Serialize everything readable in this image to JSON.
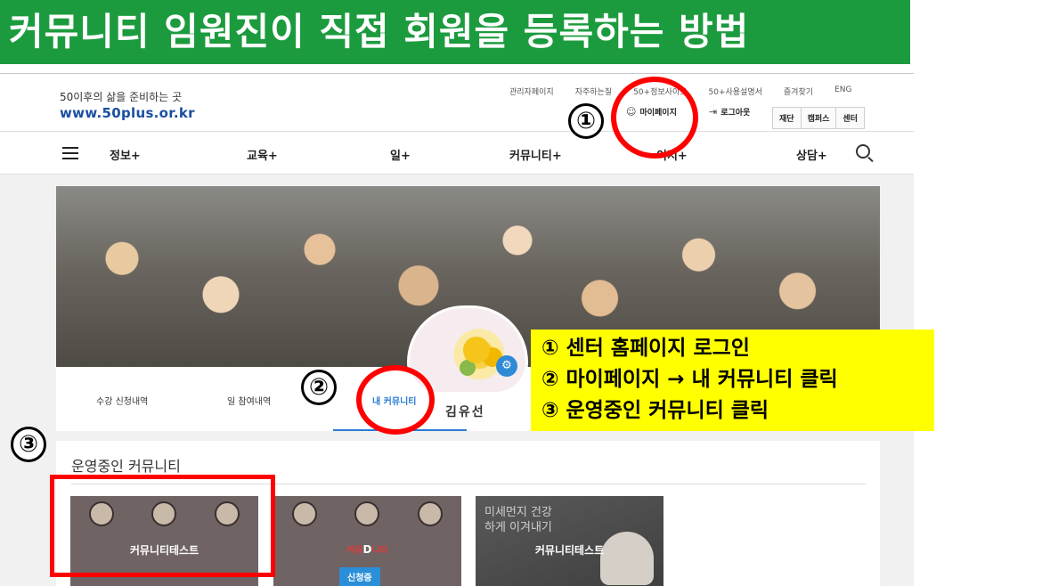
{
  "banner": {
    "title": "커뮤니티 임원진이 직접 회원을 등록하는 방법"
  },
  "header": {
    "logo_tagline": "50이후의 삶을 준비하는 곳",
    "logo_url": "www.50plus.or.kr",
    "util_links": [
      "관리자페이지",
      "자주하는질",
      "50+정보사이트",
      "50+사용설명서",
      "즐겨찾기",
      "ENG"
    ],
    "mypage_label": "마이페이지",
    "logout_label": "로그아웃",
    "buttons": [
      "재단",
      "캠퍼스",
      "센터"
    ]
  },
  "nav": {
    "items": [
      "정보+",
      "교육+",
      "일+",
      "커뮤니티+",
      "이지+",
      "상담+"
    ]
  },
  "profile": {
    "tabs": [
      "수강 신청내역",
      "일 참여내역",
      "내 커뮤니티"
    ],
    "username": "김유선"
  },
  "community": {
    "section_title": "운영중인 커뮤니티",
    "cards": [
      {
        "title": "커뮤니티테스트"
      },
      {
        "title_prefix": "커뮤",
        "title_suffix": "니티",
        "title_letter": "D",
        "badge": "신청중"
      },
      {
        "title": "커뮤니티테스트",
        "overlay_text": "미세먼지 건강하게 이겨내기"
      }
    ]
  },
  "instructions": [
    "① 센터 홈페이지 로그인",
    "② 마이페이지 → 내 커뮤니티 클릭",
    "③ 운영중인 커뮤니티 클릭"
  ],
  "markers": [
    "①",
    "②",
    "③"
  ],
  "colors": {
    "banner": "#1c9b3e",
    "highlight": "#ff0000",
    "note_bg": "#ffff00",
    "accent": "#2a7bd4"
  }
}
